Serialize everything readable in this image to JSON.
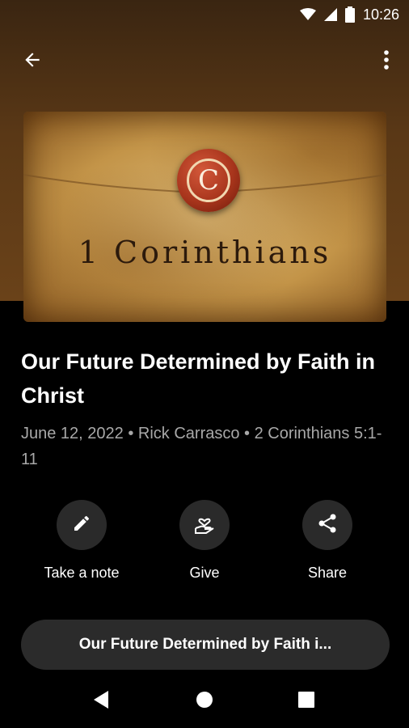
{
  "status_bar": {
    "time": "10:26",
    "icons": [
      "wifi-icon",
      "cell-signal-icon",
      "battery-icon"
    ]
  },
  "top_bar": {
    "back_icon": "arrow-back-icon",
    "menu_icon": "more-vert-icon"
  },
  "artwork": {
    "seal_letter": "C",
    "title": "1 Corinthians"
  },
  "sermon": {
    "title": "Our Future Determined by Faith in Christ",
    "meta": "June 12, 2022 • Rick Carrasco • 2 Corinthians 5:1-11"
  },
  "actions": [
    {
      "label": "Take a note",
      "icon": "pencil-icon"
    },
    {
      "label": "Give",
      "icon": "heart-hand-icon"
    },
    {
      "label": "Share",
      "icon": "share-icon"
    }
  ],
  "player": {
    "label": "Our Future Determined by Faith i..."
  },
  "nav": {
    "icons": [
      "nav-back-icon",
      "nav-home-icon",
      "nav-recents-icon"
    ]
  },
  "colors": {
    "hero_brown": "#5a3816",
    "background": "#000000",
    "button_bg": "#2a2a2a",
    "meta_text": "#a8a8a8"
  }
}
